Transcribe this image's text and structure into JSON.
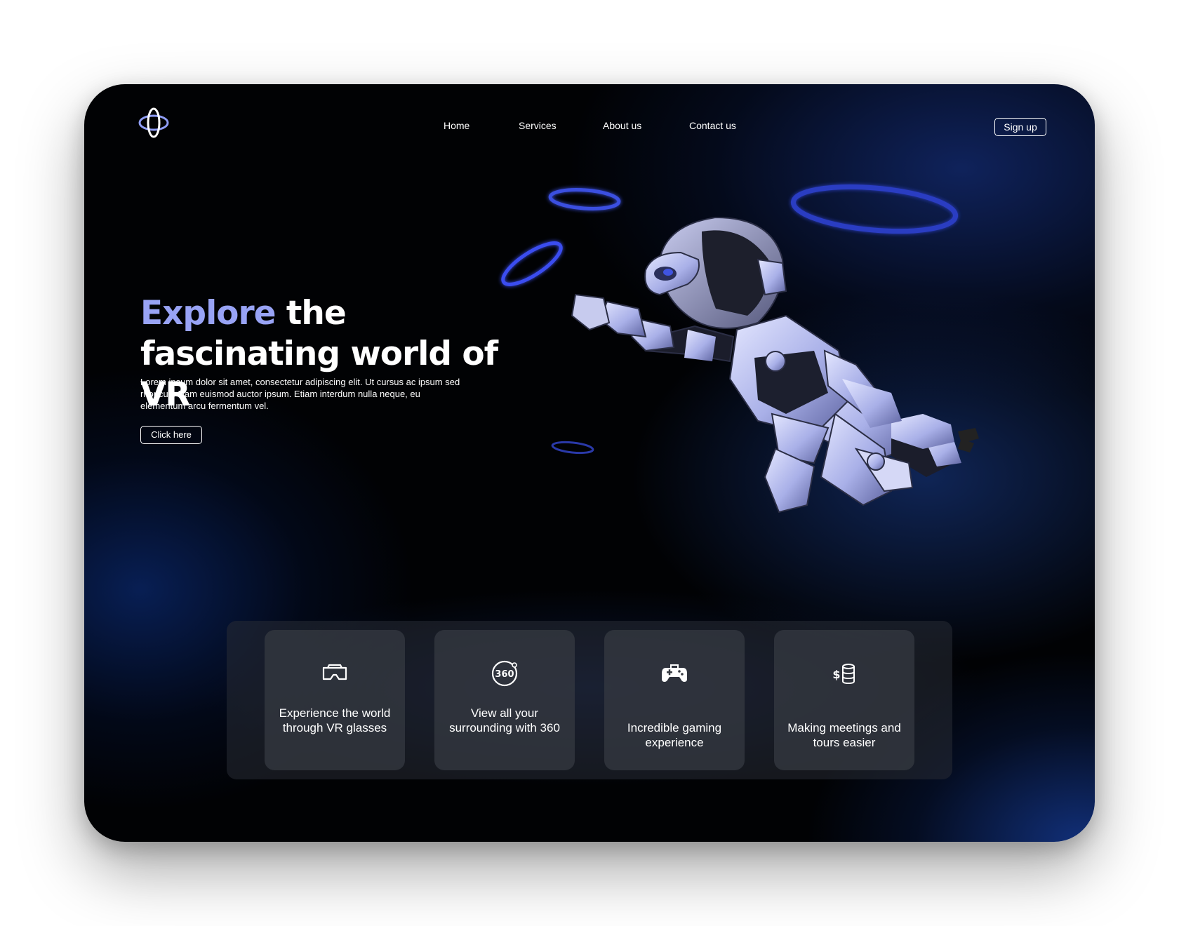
{
  "brand": {
    "logo_icon": "orbit-logo-icon"
  },
  "nav": {
    "links": [
      "Home",
      "Services",
      "About us",
      "Contact us"
    ],
    "signup_label": "Sign up"
  },
  "hero": {
    "title_accent": "Explore",
    "title_rest": " the fascinating world of VR",
    "description": "Lorem ipsum dolor sit amet, consectetur adipiscing elit. Ut cursus ac ipsum sed rhoncus. Nam euismod auctor ipsum. Etiam interdum nulla neque, eu elementum arcu fermentum vel.",
    "cta_label": "Click here",
    "image": "flying-robot-illustration"
  },
  "features": [
    {
      "icon": "vr-headset-icon",
      "text": "Experience the world through VR glasses"
    },
    {
      "icon": "360-view-icon",
      "text": "View all your surrounding with 360"
    },
    {
      "icon": "gamepad-icon",
      "text": "Incredible gaming experience"
    },
    {
      "icon": "money-coins-icon",
      "text": "Making meetings and tours easier"
    }
  ],
  "colors": {
    "accent": "#98a3f5",
    "ring": "#3347d6",
    "background": "#010204",
    "card": "#363a42"
  }
}
